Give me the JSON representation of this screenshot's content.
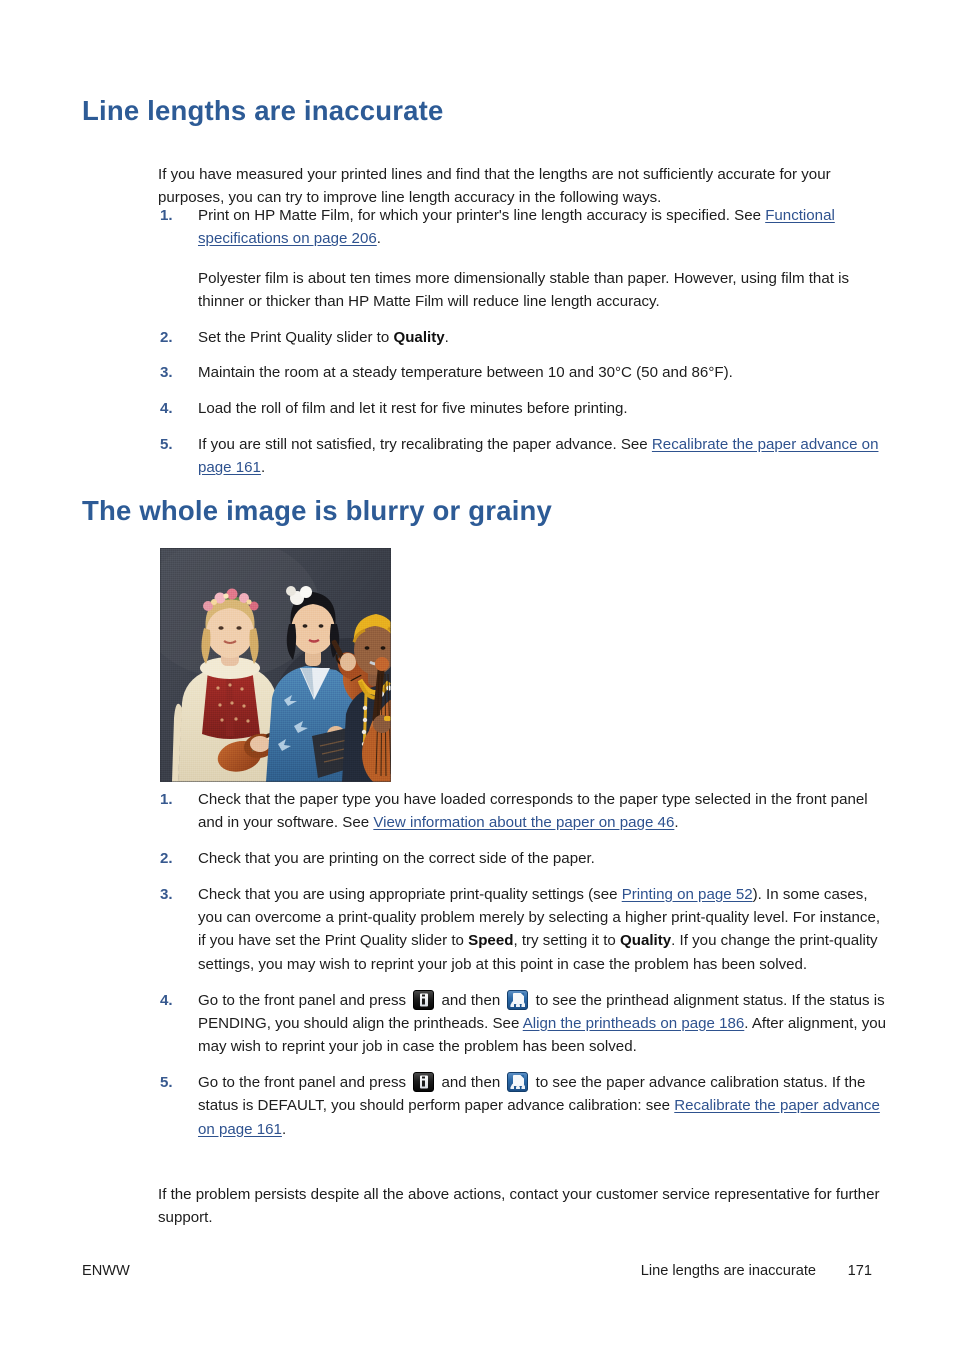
{
  "document": {
    "heading_color": "#2d5b96",
    "link_color": "#2e528f",
    "number_color": "#37598f"
  },
  "section_1": {
    "heading": "Line lengths are inaccurate",
    "intro": "If you have measured your printed lines and find that the lengths are not sufficiently accurate for your purposes, you can try to improve line length accuracy in the following ways.",
    "steps": [
      {
        "num": "1.",
        "text_before": "Print on HP Matte Film, for which your printer's line length accuracy is specified. See ",
        "link": "Functional specifications on page 206",
        "text_after": ".",
        "sub_para": "Polyester film is about ten times more dimensionally stable than paper. However, using film that is thinner or thicker than HP Matte Film will reduce line length accuracy."
      },
      {
        "num": "2.",
        "text_before": "Set the Print Quality slider to ",
        "bold": "Quality",
        "text_after": "."
      },
      {
        "num": "3.",
        "text_before": "Maintain the room at a steady temperature between 10 and 30°C (50 and 86°F)."
      },
      {
        "num": "4.",
        "text_before": "Load the roll of film and let it rest for five minutes before printing."
      },
      {
        "num": "5.",
        "text_before": "If you are still not satisfied, try recalibrating the paper advance. See ",
        "link": "Recalibrate the paper advance on page 161",
        "text_after": "."
      }
    ]
  },
  "section_2": {
    "heading": "The whole image is blurry or grainy",
    "figure": {
      "alt": "Photograph of three women musicians in traditional costumes holding stringed instruments, printed with visible graininess"
    },
    "steps": [
      {
        "num": "1.",
        "text_before": "Check that the paper type you have loaded corresponds to the paper type selected in the front panel and in your software. See ",
        "link": "View information about the paper on page 46",
        "text_after": "."
      },
      {
        "num": "2.",
        "text_before": "Check that you are printing on the correct side of the paper."
      },
      {
        "num": "3.",
        "seg_1": "Check that you are using appropriate print-quality settings (see ",
        "link_1": "Printing on page 52",
        "seg_2": "). In some cases, you can overcome a print-quality problem merely by selecting a higher print-quality level. For instance, if you have set the Print Quality slider to ",
        "bold_1": "Speed",
        "seg_3": ", try setting it to ",
        "bold_2": "Quality",
        "seg_4": ". If you change the print-quality settings, you may wish to reprint your job at this point in case the problem has been solved."
      },
      {
        "num": "4.",
        "seg_1": "Go to the front panel and press ",
        "icon_1": "front-panel-info-icon",
        "seg_2": " and then ",
        "icon_2": "front-panel-printhead-icon",
        "seg_3": " to see the printhead alignment status. If the status is PENDING, you should align the printheads. See ",
        "link_1": "Align the printheads on page 186",
        "seg_4": ". After alignment, you may wish to reprint your job in case the problem has been solved."
      },
      {
        "num": "5.",
        "seg_1": "Go to the front panel and press ",
        "icon_1": "front-panel-info-icon",
        "seg_2": " and then ",
        "icon_2": "front-panel-printhead-icon",
        "seg_3": " to see the paper advance calibration status. If the status is DEFAULT, you should perform paper advance calibration: see ",
        "link_1": "Recalibrate the paper advance on page 161",
        "seg_4": "."
      }
    ],
    "closing": "If the problem persists despite all the above actions, contact your customer service representative for further support."
  },
  "footer": {
    "left": "ENWW",
    "running_head": "Line lengths are inaccurate",
    "page_number": "171"
  }
}
